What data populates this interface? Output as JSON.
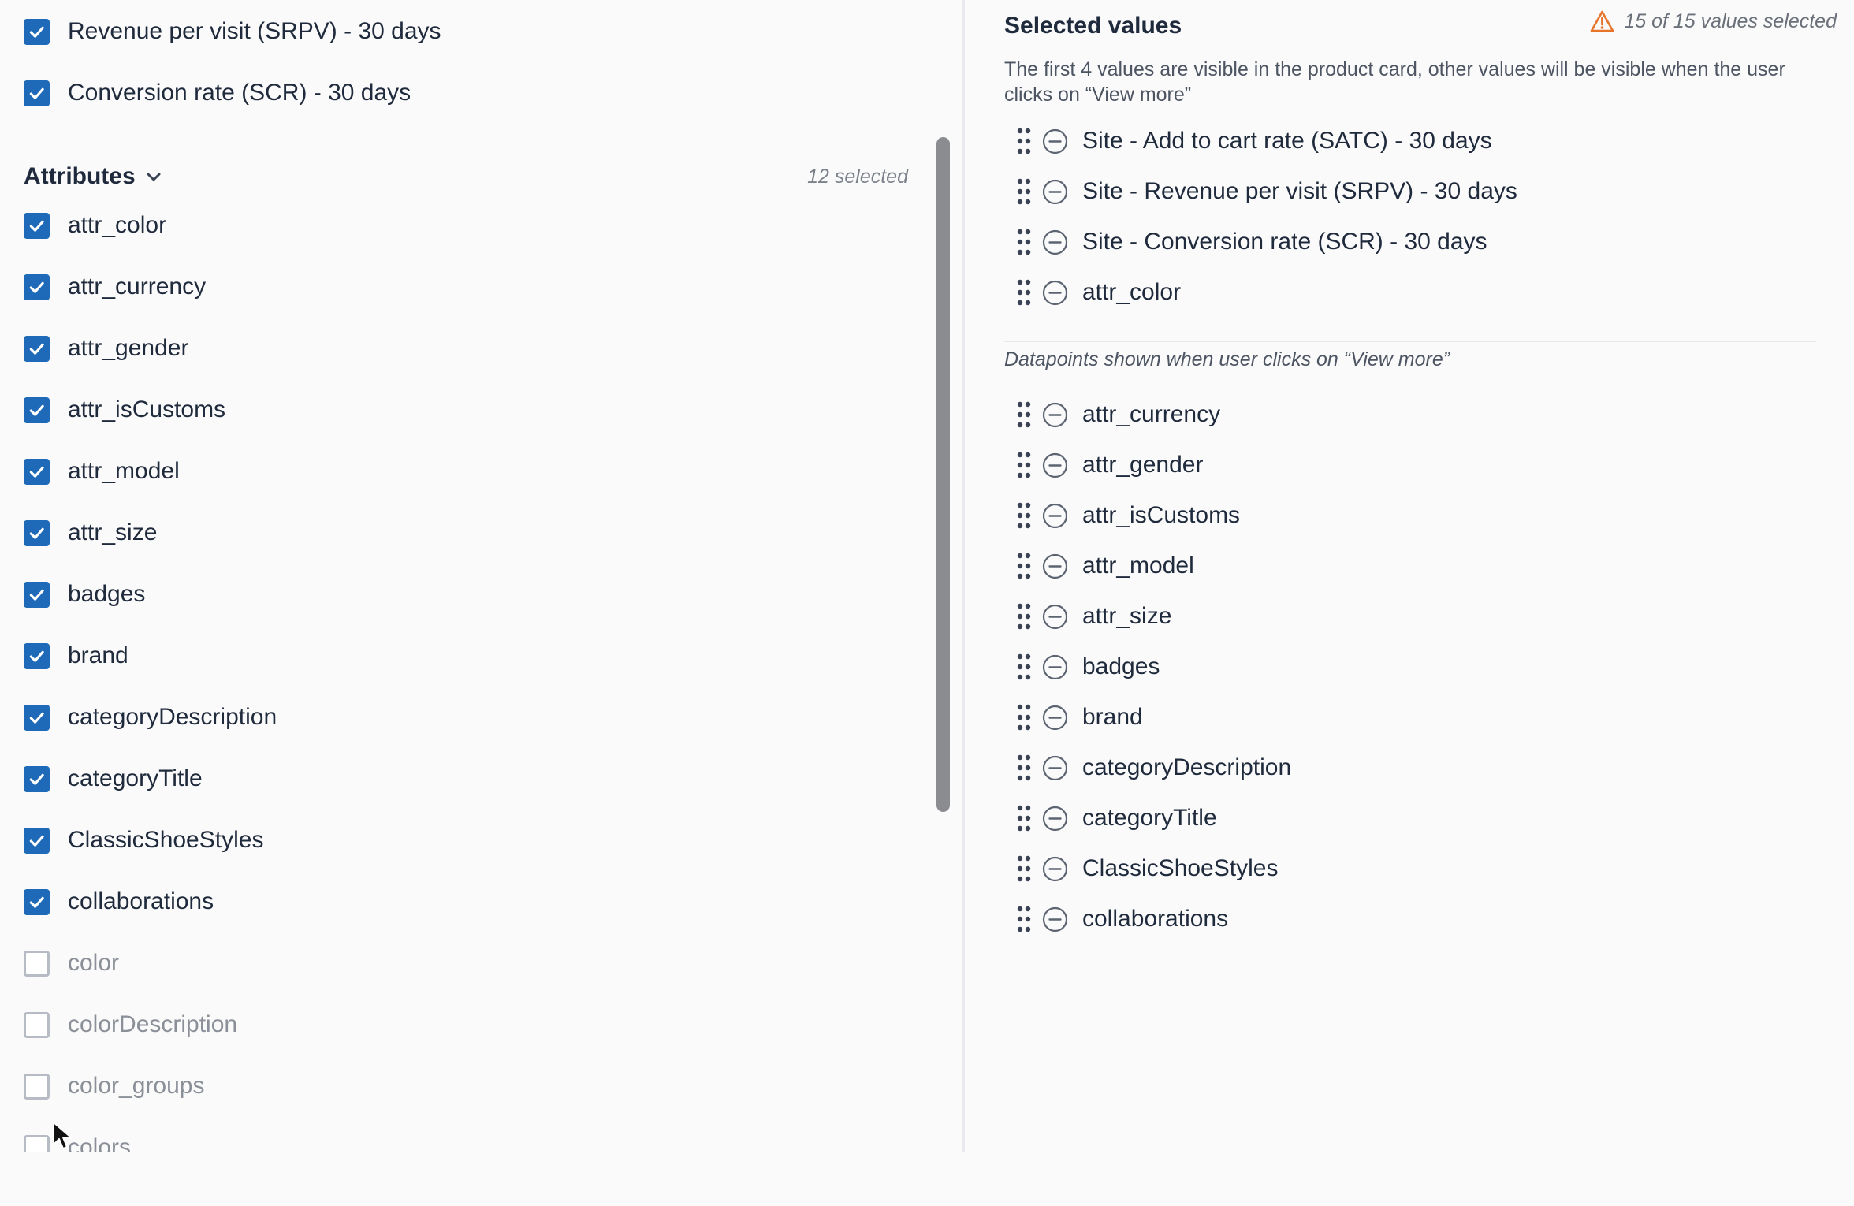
{
  "metrics": [
    {
      "label": "Revenue per visit (SRPV) - 30 days",
      "checked": true
    },
    {
      "label": "Conversion rate (SCR) - 30 days",
      "checked": true
    }
  ],
  "attributes": {
    "title": "Attributes",
    "count_label": "12 selected",
    "items": [
      {
        "label": "attr_color",
        "checked": true
      },
      {
        "label": "attr_currency",
        "checked": true
      },
      {
        "label": "attr_gender",
        "checked": true
      },
      {
        "label": "attr_isCustoms",
        "checked": true
      },
      {
        "label": "attr_model",
        "checked": true
      },
      {
        "label": "attr_size",
        "checked": true
      },
      {
        "label": "badges",
        "checked": true
      },
      {
        "label": "brand",
        "checked": true
      },
      {
        "label": "categoryDescription",
        "checked": true
      },
      {
        "label": "categoryTitle",
        "checked": true
      },
      {
        "label": "ClassicShoeStyles",
        "checked": true
      },
      {
        "label": "collaborations",
        "checked": true
      },
      {
        "label": "color",
        "checked": false
      },
      {
        "label": "colorDescription",
        "checked": false
      },
      {
        "label": "color_groups",
        "checked": false
      },
      {
        "label": "colors",
        "checked": false
      }
    ]
  },
  "selected": {
    "title": "Selected values",
    "status": "15 of 15 values selected",
    "description": "The first 4 values are visible in the product card, other values will be visible when the user clicks on “View more”",
    "visible_values": [
      "Site - Add to cart rate (SATC) - 30 days",
      "Site - Revenue per visit (SRPV) - 30 days",
      "Site - Conversion rate (SCR) - 30 days",
      "attr_color"
    ],
    "more_heading": "Datapoints shown when user clicks on “View more”",
    "more_values": [
      "attr_currency",
      "attr_gender",
      "attr_isCustoms",
      "attr_model",
      "attr_size",
      "badges",
      "brand",
      "categoryDescription",
      "categoryTitle",
      "ClassicShoeStyles",
      "collaborations"
    ]
  },
  "colors": {
    "accent": "#1f6ab8",
    "warning": "#e8742a",
    "text": "#1f2a3c"
  },
  "icons": {
    "checkbox_checked": "check-icon",
    "section_toggle": "chevron-down-icon",
    "warning": "warning-icon",
    "drag": "drag-handle-icon",
    "remove": "minus-circle-icon",
    "cursor": "mouse-cursor-icon"
  }
}
